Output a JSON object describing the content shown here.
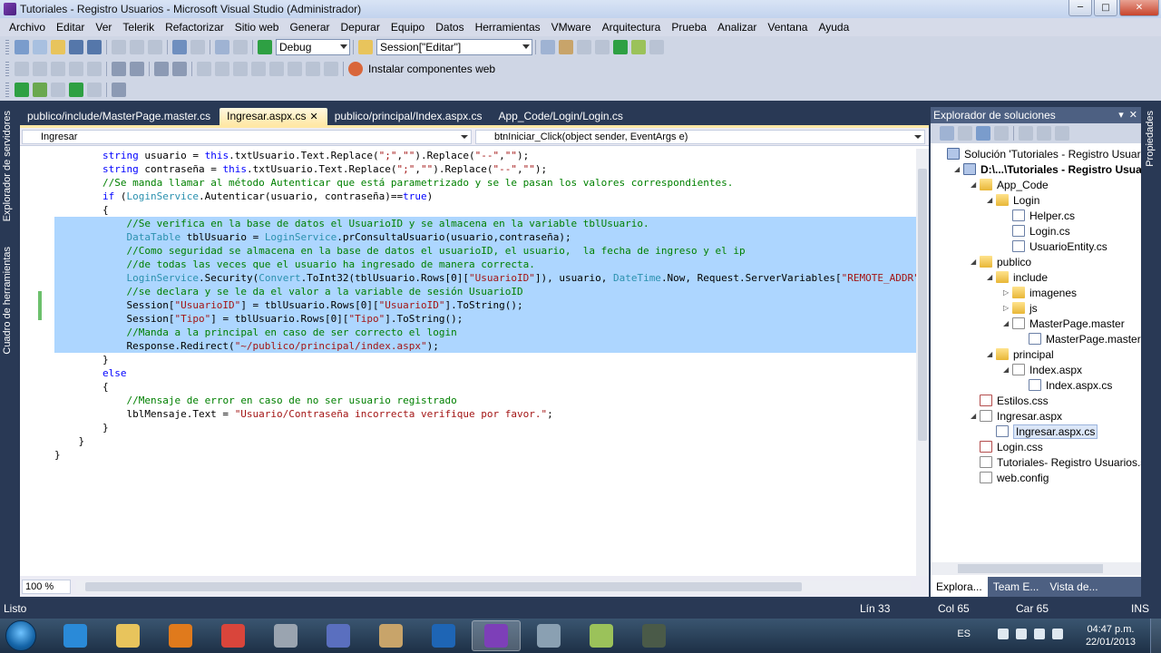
{
  "window": {
    "title": "Tutoriales - Registro Usuarios - Microsoft Visual Studio (Administrador)",
    "min": "─",
    "max": "□",
    "close": "✕"
  },
  "menu": [
    "Archivo",
    "Editar",
    "Ver",
    "Telerik",
    "Refactorizar",
    "Sitio web",
    "Generar",
    "Depurar",
    "Equipo",
    "Datos",
    "Herramientas",
    "VMware",
    "Arquitectura",
    "Prueba",
    "Analizar",
    "Ventana",
    "Ayuda"
  ],
  "toolbar": {
    "config": "Debug",
    "find": "Session[\"Editar\"]",
    "install_components": "Instalar componentes web"
  },
  "left_tabs": {
    "server_explorer": "Explorador de servidores",
    "toolbox": "Cuadro de herramientas"
  },
  "right_tabs": {
    "properties": "Propiedades"
  },
  "doc_tabs": [
    {
      "label": "publico/include/MasterPage.master.cs"
    },
    {
      "label": "Ingresar.aspx.cs",
      "active": true
    },
    {
      "label": "publico/principal/Index.aspx.cs"
    },
    {
      "label": "App_Code/Login/Login.cs"
    }
  ],
  "tab_close": "✕",
  "editor": {
    "class_combo": "Ingresar",
    "method_combo": "btnIniciar_Click(object sender, EventArgs e)",
    "zoom": "100 %"
  },
  "code_lines": [
    "        string usuario = this.txtUsuario.Text.Replace(\";\",\"\").Replace(\"--\",\"\");",
    "        string contraseña = this.txtUsuario.Text.Replace(\";\",\"\").Replace(\"--\",\"\");",
    "        //Se manda llamar al método Autenticar que está parametrizado y se le pasan los valores correspondientes.",
    "        if (LoginService.Autenticar(usuario, contraseña)==true)",
    "        {",
    "            //Se verifica en la base de datos el UsuarioID y se almacena en la variable tblUsuario.",
    "            DataTable tblUsuario = LoginService.prConsultaUsuario(usuario,contraseña);",
    "            //Como seguridad se almacena en la base de datos el usuarioID, el usuario,  la fecha de ingreso y el ip",
    "            //de todas las veces que el usuario ha ingresado de manera correcta.",
    "            LoginService.Security(Convert.ToInt32(tblUsuario.Rows[0][\"UsuarioID\"]), usuario, DateTime.Now, Request.ServerVariables[\"REMOTE_ADDR\"",
    "            //se declara y se le da el valor a la variable de sesión UsuarioID",
    "            Session[\"UsuarioID\"] = tblUsuario.Rows[0][\"UsuarioID\"].ToString();",
    "            Session[\"Tipo\"] = tblUsuario.Rows[0][\"Tipo\"].ToString();",
    "            //Manda a la principal en caso de ser correcto el login",
    "            Response.Redirect(\"~/publico/principal/index.aspx\");",
    "        }",
    "        else",
    "        {",
    "            //Mensaje de error en caso de no ser usuario registrado",
    "            lblMensaje.Text = \"Usuario/Contraseña incorrecta verifique por favor.\";",
    "        }",
    "    }",
    "}"
  ],
  "solution_explorer": {
    "title": "Explorador de soluciones",
    "pin": "▾",
    "close": "✕",
    "tree": [
      {
        "label": "Solución 'Tutoriales - Registro Usuarios'",
        "indent": 0,
        "icon": "solution"
      },
      {
        "label": "D:\\...\\Tutoriales - Registro Usuarios\\",
        "indent": 1,
        "icon": "project",
        "expanded": true,
        "bold": true
      },
      {
        "label": "App_Code",
        "indent": 2,
        "icon": "folder",
        "expanded": true
      },
      {
        "label": "Login",
        "indent": 3,
        "icon": "folder",
        "expanded": true
      },
      {
        "label": "Helper.cs",
        "indent": 4,
        "icon": "cs"
      },
      {
        "label": "Login.cs",
        "indent": 4,
        "icon": "cs"
      },
      {
        "label": "UsuarioEntity.cs",
        "indent": 4,
        "icon": "cs"
      },
      {
        "label": "publico",
        "indent": 2,
        "icon": "folder",
        "expanded": true
      },
      {
        "label": "include",
        "indent": 3,
        "icon": "folder",
        "expanded": true
      },
      {
        "label": "imagenes",
        "indent": 4,
        "icon": "folder",
        "collapsed": true
      },
      {
        "label": "js",
        "indent": 4,
        "icon": "folder",
        "collapsed": true
      },
      {
        "label": "MasterPage.master",
        "indent": 4,
        "icon": "page",
        "expanded": true
      },
      {
        "label": "MasterPage.master.cs",
        "indent": 5,
        "icon": "cs"
      },
      {
        "label": "principal",
        "indent": 3,
        "icon": "folder",
        "expanded": true
      },
      {
        "label": "Index.aspx",
        "indent": 4,
        "icon": "page",
        "expanded": true
      },
      {
        "label": "Index.aspx.cs",
        "indent": 5,
        "icon": "cs"
      },
      {
        "label": "Estilos.css",
        "indent": 2,
        "icon": "css"
      },
      {
        "label": "Ingresar.aspx",
        "indent": 2,
        "icon": "page",
        "expanded": true
      },
      {
        "label": "Ingresar.aspx.cs",
        "indent": 3,
        "icon": "cs",
        "selected": true
      },
      {
        "label": "Login.css",
        "indent": 2,
        "icon": "css"
      },
      {
        "label": "Tutoriales- Registro Usuarios.sql",
        "indent": 2,
        "icon": "page"
      },
      {
        "label": "web.config",
        "indent": 2,
        "icon": "page"
      }
    ],
    "bottom_tabs": [
      "Explora...",
      "Team E...",
      "Vista de..."
    ]
  },
  "status": {
    "ready": "Listo",
    "line": "Lín 33",
    "col": "Col 65",
    "car": "Car 65",
    "mode": "INS"
  },
  "taskbar": {
    "lang": "ES",
    "time": "04:47 p.m.",
    "date": "22/01/2013",
    "apps": [
      {
        "name": "internet-explorer",
        "color": "#2a8ad8"
      },
      {
        "name": "file-explorer",
        "color": "#e8c45c"
      },
      {
        "name": "media-player",
        "color": "#e07a1c"
      },
      {
        "name": "chrome",
        "color": "#d9453b"
      },
      {
        "name": "calculator",
        "color": "#9aa4b0"
      },
      {
        "name": "network-tool",
        "color": "#5a6fbf"
      },
      {
        "name": "tools",
        "color": "#c8a46a"
      },
      {
        "name": "outlook",
        "color": "#1e65b5"
      },
      {
        "name": "visual-studio",
        "color": "#7d3fb8",
        "active": true
      },
      {
        "name": "tool-app",
        "color": "#8aa0b2"
      },
      {
        "name": "notes",
        "color": "#9bc25a"
      },
      {
        "name": "cmd-app",
        "color": "#4a5a48"
      }
    ]
  }
}
